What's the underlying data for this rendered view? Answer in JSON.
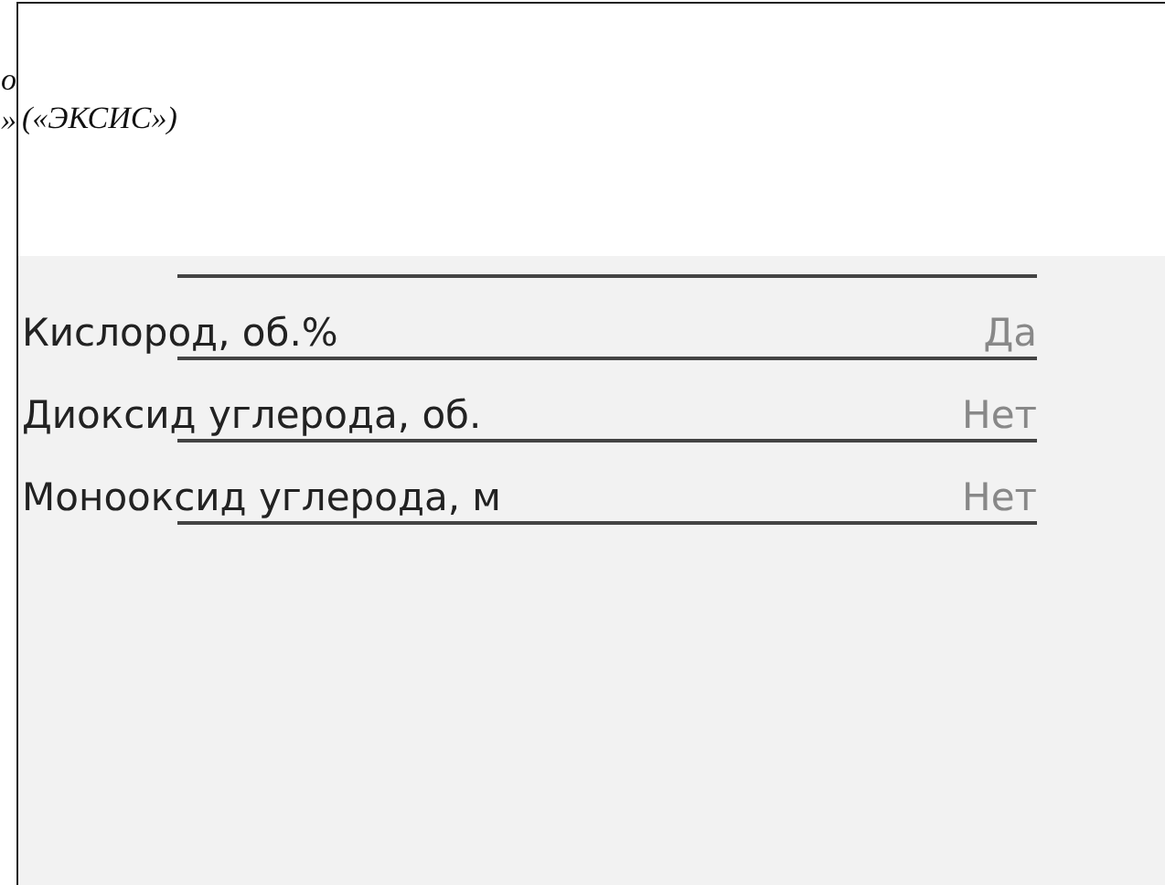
{
  "left_fragments": [
    "о",
    "»"
  ],
  "caption": "(«ЭКСИС»)",
  "rows": [
    {
      "label": "Кислород, об.%",
      "value": "Да"
    },
    {
      "label": "Диоксид углерода, об.",
      "value": "Нет"
    },
    {
      "label": "Монооксид углерода, м",
      "value": "Нет"
    }
  ]
}
